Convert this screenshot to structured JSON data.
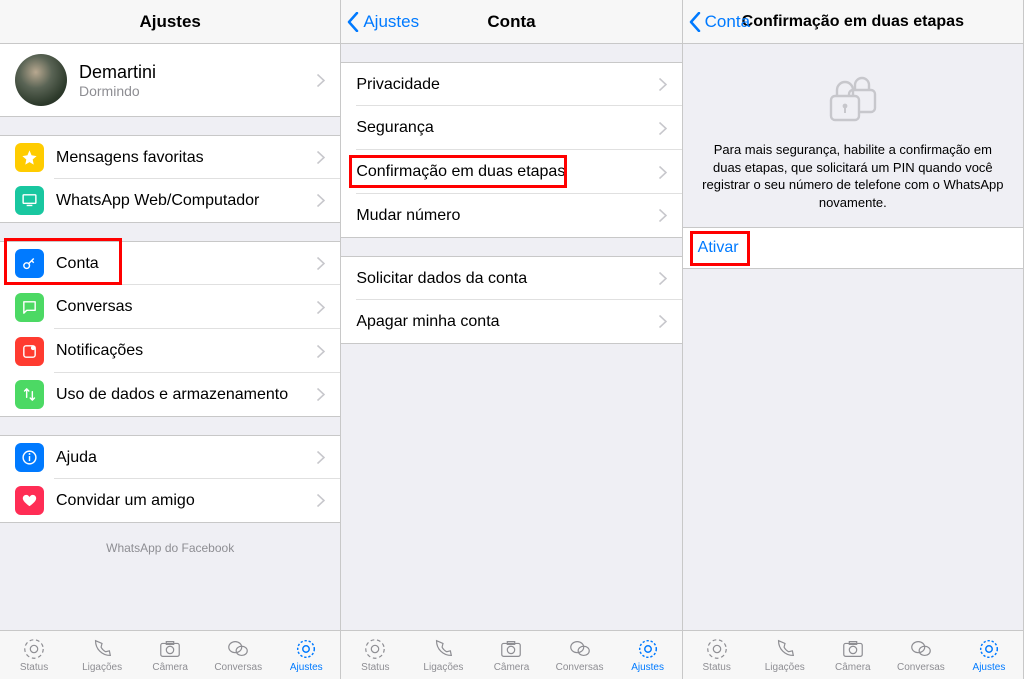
{
  "tabs": {
    "status": "Status",
    "calls": "Ligações",
    "camera": "Câmera",
    "chats": "Conversas",
    "settings": "Ajustes"
  },
  "screen1": {
    "title": "Ajustes",
    "profile": {
      "name": "Demartini",
      "status": "Dormindo"
    },
    "rows": {
      "starred": "Mensagens favoritas",
      "web": "WhatsApp Web/Computador",
      "account": "Conta",
      "chats": "Conversas",
      "notifications": "Notificações",
      "data": "Uso de dados e armazenamento",
      "help": "Ajuda",
      "invite": "Convidar um amigo"
    },
    "footer": "WhatsApp do Facebook"
  },
  "screen2": {
    "back": "Ajustes",
    "title": "Conta",
    "rows": {
      "privacy": "Privacidade",
      "security": "Segurança",
      "twostep": "Confirmação em duas etapas",
      "changeNumber": "Mudar número",
      "request": "Solicitar dados da conta",
      "delete": "Apagar minha conta"
    }
  },
  "screen3": {
    "back": "Conta",
    "title": "Confirmação em duas etapas",
    "desc": "Para mais segurança, habilite a confirmação em duas etapas, que solicitará um PIN quando você registrar o seu número de telefone com o WhatsApp novamente.",
    "activate": "Ativar"
  }
}
